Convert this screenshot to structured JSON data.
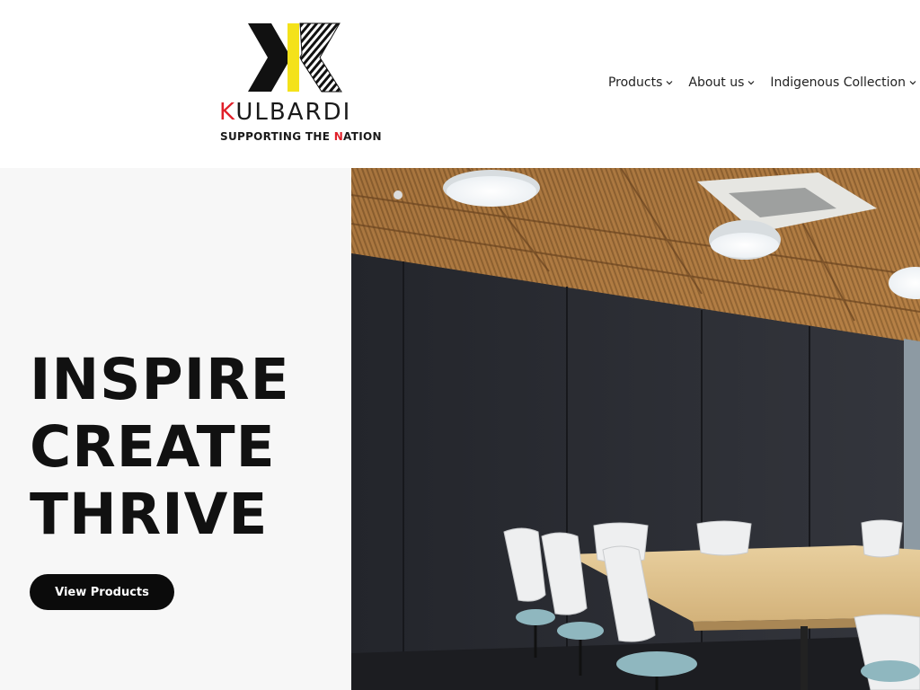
{
  "brand": {
    "name_first_letter": "K",
    "name_rest": "ULBARDI",
    "tagline_before": "SUPPORTING THE ",
    "tagline_highlight": "N",
    "tagline_after": "ATION",
    "colors": {
      "accent_red": "#e0202a",
      "accent_yellow": "#f4e21a",
      "dark": "#111111"
    }
  },
  "nav": {
    "items": [
      {
        "label": "Products",
        "icon": "chevron-down-icon"
      },
      {
        "label": "About us",
        "icon": "chevron-down-icon"
      },
      {
        "label": "Indigenous Collection",
        "icon": "chevron-down-icon"
      }
    ]
  },
  "hero": {
    "headline": [
      "INSPIRE",
      "CREATE",
      "THRIVE"
    ],
    "cta_label": "View Products",
    "image_subject": "meeting-room-photo"
  }
}
